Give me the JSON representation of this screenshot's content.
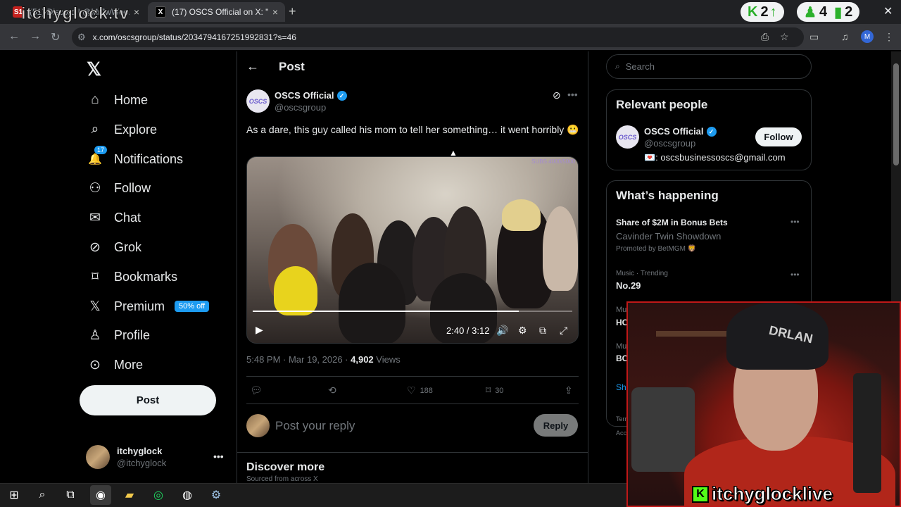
{
  "browser": {
    "tabs": [
      {
        "label": "(51) Discord | @MrJwWoo...",
        "favicon": "S1"
      },
      {
        "label": "(17) OSCS Official on X: \"As a d",
        "favicon": "X"
      }
    ],
    "url": "x.com/oscsgroup/status/2034794167251992831?s=46",
    "profile_initial": "M"
  },
  "overlay": {
    "watermark_top": "itchyglock.tv",
    "counters": [
      {
        "icon": "kick-logo",
        "value": "2",
        "arrow": "↑"
      },
      {
        "icon": "person-icon",
        "value": "4"
      },
      {
        "icon": "bars-icon",
        "value": "2"
      }
    ],
    "watermark_bottom": "itchyglocklive"
  },
  "nav": {
    "logo": "𝕏",
    "items": [
      {
        "label": "Home",
        "icon": "⌂"
      },
      {
        "label": "Explore",
        "icon": "⌕"
      },
      {
        "label": "Notifications",
        "icon": "🔔",
        "badge": "17"
      },
      {
        "label": "Follow",
        "icon": "👤"
      },
      {
        "label": "Chat",
        "icon": "✉"
      },
      {
        "label": "Grok",
        "icon": "⊘"
      },
      {
        "label": "Bookmarks",
        "icon": "🔖"
      },
      {
        "label": "Premium",
        "icon": "𝕏",
        "pill": "50% off"
      },
      {
        "label": "Profile",
        "icon": "👤"
      },
      {
        "label": "More",
        "icon": "⋯"
      }
    ],
    "post_button": "Post",
    "account": {
      "name": "itchyglock",
      "handle": "@itchyglock"
    }
  },
  "post": {
    "header": "Post",
    "author": {
      "name": "OSCS Official",
      "handle": "@oscsgroup",
      "avatar_text": "OSCS"
    },
    "text": "As a dare, this guy called his mom to tell her something… it went horribly 😬",
    "video": {
      "time": "2:40 / 3:12",
      "progress": 0.833,
      "corner_label": "SUBS 4000/5000"
    },
    "time": "5:48 PM · Mar 19, 2026 · ",
    "views_count": "4,902",
    "views_label": " Views",
    "actions": {
      "likes": "188",
      "bookmarks": "30"
    },
    "reply_placeholder": "Post your reply",
    "reply_button": "Reply"
  },
  "discover": {
    "title": "Discover more",
    "subtitle": "Sourced from across X"
  },
  "sidebar": {
    "search_placeholder": "Search",
    "relevant": {
      "title": "Relevant people",
      "name": "OSCS Official",
      "handle": "@oscsgroup",
      "bio": "💌: oscsbusinessoscs@gmail.com",
      "follow": "Follow"
    },
    "happening": {
      "title": "What’s happening",
      "trend1_title": "Share of $2M in Bonus Bets",
      "trend1_sub": "Cavinder Twin Showdown",
      "trend1_promo": "Promoted by BetMGM 🦁",
      "trend2_cat": "Music · Trending",
      "trend2_title": "No.29",
      "cut1_cat": "Mu",
      "cut1_title": "HC",
      "cut2_cat": "Mu",
      "cut2_title": "BC",
      "show_more": "Sh",
      "foot1": "Terr",
      "foot2": "Acc"
    }
  },
  "webcam": {
    "hat_text": "DRLAN"
  }
}
